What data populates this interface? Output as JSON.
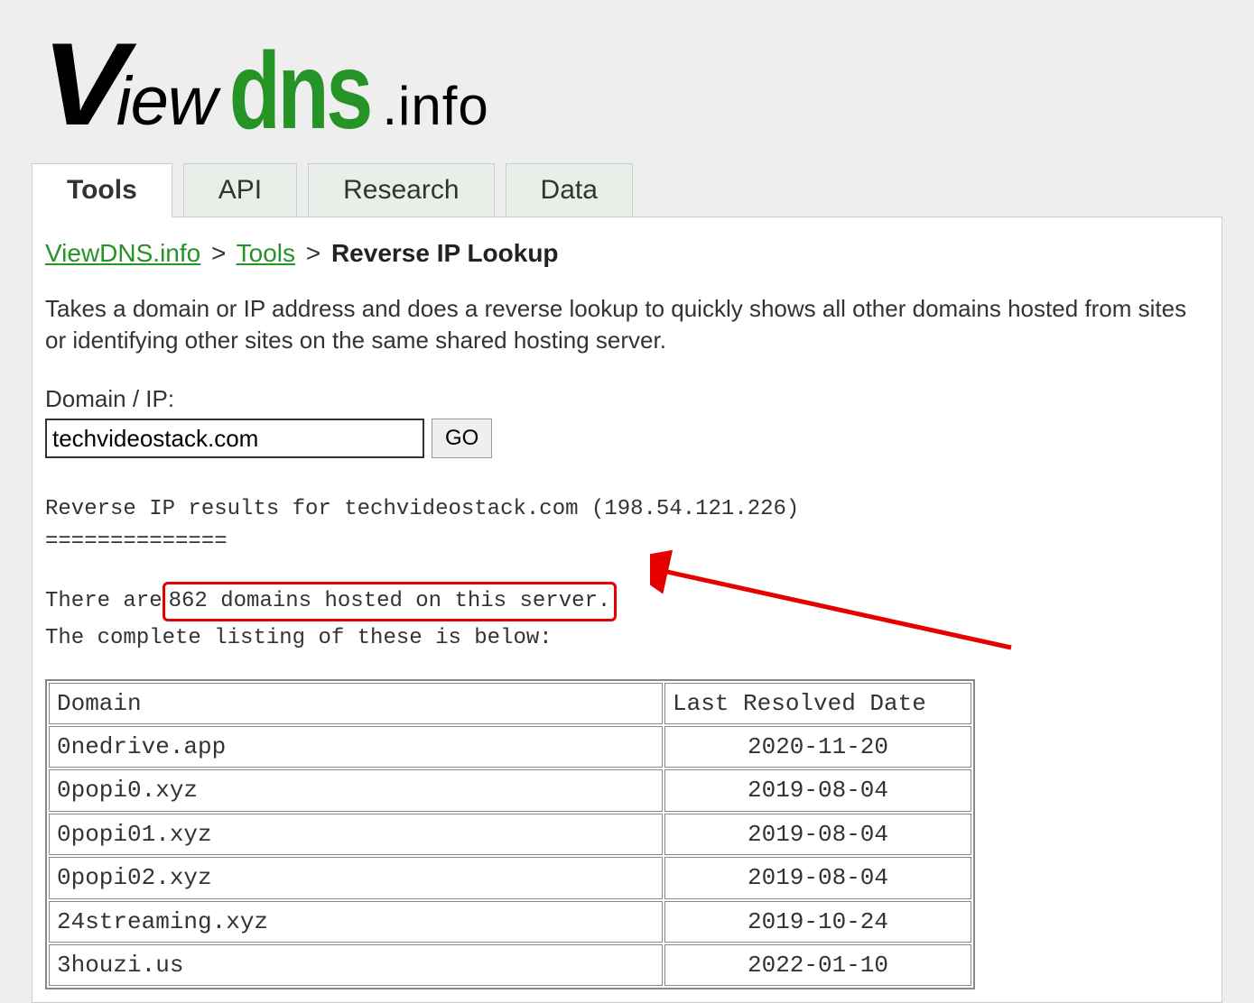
{
  "logo": {
    "part1_v": "V",
    "part1_iew": "iew",
    "part2": "dns",
    "part3": ".info"
  },
  "tabs": [
    {
      "label": "Tools",
      "active": true
    },
    {
      "label": "API",
      "active": false
    },
    {
      "label": "Research",
      "active": false
    },
    {
      "label": "Data",
      "active": false
    }
  ],
  "breadcrumb": {
    "link1": "ViewDNS.info",
    "link2": "Tools",
    "sep": ">",
    "current": "Reverse IP Lookup"
  },
  "description": "Takes a domain or IP address and does a reverse lookup to quickly shows all other domains hosted from sites or identifying other sites on the same shared hosting server.",
  "form": {
    "label": "Domain / IP:",
    "value": "techvideostack.com",
    "button": "GO"
  },
  "results": {
    "header": "Reverse IP results for techvideostack.com (198.54.121.226)",
    "divider": "==============",
    "count_prefix": "There are",
    "count_highlight": " 862 domains hosted on this server.",
    "listing": "The complete listing of these is below:",
    "columns": {
      "domain": "Domain",
      "date": "Last Resolved Date"
    },
    "rows": [
      {
        "domain": "0nedrive.app",
        "date": "2020-11-20"
      },
      {
        "domain": "0popi0.xyz",
        "date": "2019-08-04"
      },
      {
        "domain": "0popi01.xyz",
        "date": "2019-08-04"
      },
      {
        "domain": "0popi02.xyz",
        "date": "2019-08-04"
      },
      {
        "domain": "24streaming.xyz",
        "date": "2019-10-24"
      },
      {
        "domain": "3houzi.us",
        "date": "2022-01-10"
      }
    ]
  }
}
